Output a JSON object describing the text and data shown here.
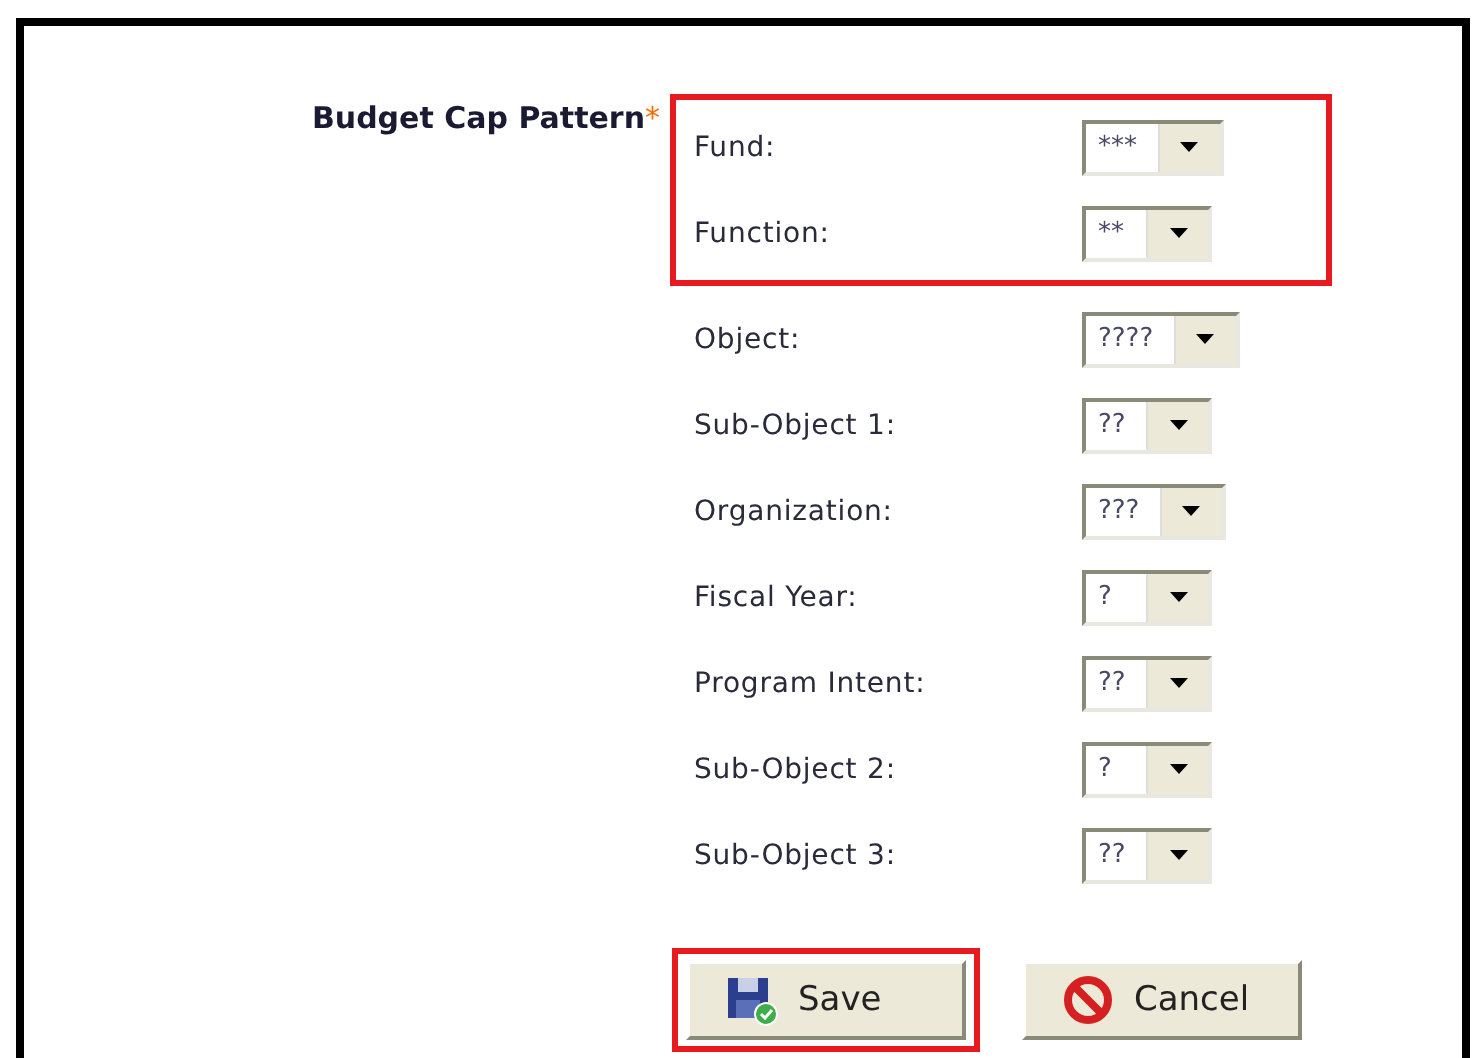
{
  "title": "Budget Cap Pattern",
  "required_mark": "*",
  "field_groups": [
    {
      "highlighted": true,
      "fields": [
        {
          "label": "Fund:",
          "value": "***"
        },
        {
          "label": "Function:",
          "value": "**"
        }
      ]
    },
    {
      "highlighted": false,
      "fields": [
        {
          "label": "Object:",
          "value": "????"
        },
        {
          "label": "Sub-Object 1:",
          "value": "??"
        },
        {
          "label": "Organization:",
          "value": "???"
        },
        {
          "label": "Fiscal Year:",
          "value": "?"
        },
        {
          "label": "Program Intent:",
          "value": "??"
        },
        {
          "label": "Sub-Object 2:",
          "value": "?"
        },
        {
          "label": "Sub-Object 3:",
          "value": "??"
        }
      ]
    }
  ],
  "buttons": [
    {
      "label": "Save",
      "kind": "save",
      "highlighted": true
    },
    {
      "label": "Cancel",
      "kind": "cancel",
      "highlighted": false
    }
  ]
}
